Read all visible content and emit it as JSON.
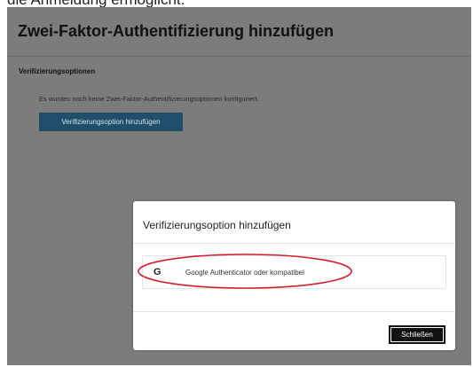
{
  "caption": {
    "text": "die Anmeldung ermöglicht."
  },
  "page": {
    "title": "Zwei-Faktor-Authentifizierung hinzufügen",
    "section_label": "Verifizierungsoptionen",
    "info_text": "Es wurden noch keine Zwei-Faktor-Authentifizierungsoptionen konfiguriert.",
    "add_button_label": "Verifizierungsoption hinzufügen"
  },
  "modal": {
    "title": "Verifizierungsoption hinzufügen",
    "options": [
      {
        "icon": "google-g-icon",
        "glyph": "G",
        "label": "Google Authenticator oder kompatibel"
      }
    ],
    "close_label": "Schließen",
    "highlight_color": "#d0202a"
  },
  "colors": {
    "overlay": "#7c7c7c",
    "primary_button": "#1f4f6a",
    "close_button": "#111111"
  }
}
